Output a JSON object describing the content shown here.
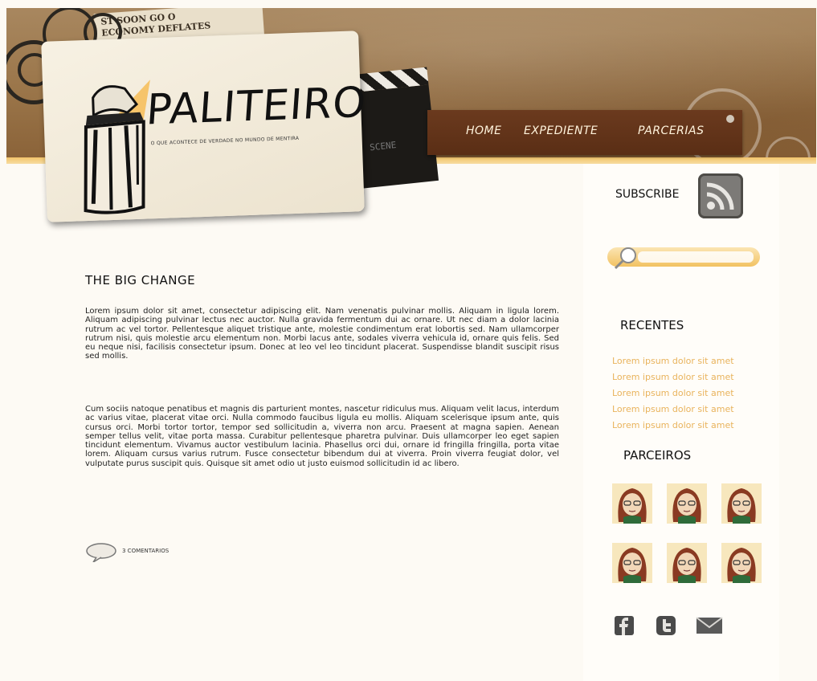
{
  "header": {
    "logo": {
      "title": "PALITEIRO",
      "tagline": "O QUE ACONTECE DE VERDADE NO MUNDO DE MENTIRA"
    },
    "newspaper_text": [
      "ST  SOON  GO  O",
      "ECONOMY  DEFLATES"
    ],
    "clapper_text": "SCENE",
    "nav": [
      {
        "label": "HOME"
      },
      {
        "label": "EXPEDIENTE"
      },
      {
        "label": "PARCERIAS"
      }
    ]
  },
  "post": {
    "title": "THE BIG CHANGE",
    "paragraphs": [
      "Lorem ipsum dolor sit amet, consectetur adipiscing elit. Nam venenatis pulvinar mollis. Aliquam in ligula lorem. Aliquam adipiscing pulvinar lectus nec auctor. Nulla gravida fermentum dui ac ornare. Ut nec diam a dolor lacinia rutrum ac vel tortor. Pellentesque aliquet tristique ante, molestie condimentum erat lobortis sed. Nam ullamcorper rutrum nisi, quis molestie arcu elementum non. Morbi lacus ante, sodales viverra vehicula id, ornare quis felis. Sed eu neque nisi, facilisis consectetur ipsum. Donec at leo vel leo tincidunt placerat. Suspendisse blandit suscipit risus sed mollis.",
      "Cum sociis natoque penatibus et magnis dis parturient montes, nascetur ridiculus mus. Aliquam velit lacus, interdum ac varius vitae, placerat vitae orci. Nulla commodo faucibus ligula eu mollis. Aliquam scelerisque ipsum ante, quis cursus orci. Morbi tortor tortor, tempor sed sollicitudin a, viverra non arcu. Praesent at magna sapien. Aenean semper tellus velit, vitae porta massa. Curabitur pellentesque pharetra pulvinar. Duis ullamcorper leo eget sapien tincidunt elementum. Vivamus auctor vestibulum lacinia. Phasellus orci dui, ornare id fringilla fringilla, porta vitae lorem. Aliquam cursus varius rutrum. Fusce consectetur bibendum dui at viverra. Proin viverra feugiat dolor, vel vulputate purus suscipit quis. Quisque sit amet odio ut justo euismod sollicitudin id ac libero."
    ],
    "comments_label": "3 COMENTARIOS",
    "comments_icon": "speech-bubble-icon"
  },
  "sidebar": {
    "subscribe_label": "SUBSCRIBE",
    "rss_icon": "rss-icon",
    "search": {
      "icon": "magnifier-icon",
      "placeholder": ""
    },
    "recent": {
      "title": "RECENTES",
      "items": [
        "Lorem ipsum dolor sit amet",
        "Lorem ipsum dolor sit amet",
        "Lorem ipsum dolor sit amet",
        "Lorem ipsum dolor sit amet",
        "Lorem ipsum dolor sit amet"
      ]
    },
    "partners": {
      "title": "PARCEIROS",
      "count": 6,
      "avatar_icon": "cartoon-face-icon"
    },
    "social": [
      "facebook-icon",
      "twitter-icon",
      "mail-icon"
    ]
  },
  "colors": {
    "accent": "#f2c262",
    "link": "#e9b35c",
    "nav_bar": "#5a2e15",
    "header": "#9a7549",
    "page_bg": "#fdfaf4"
  }
}
